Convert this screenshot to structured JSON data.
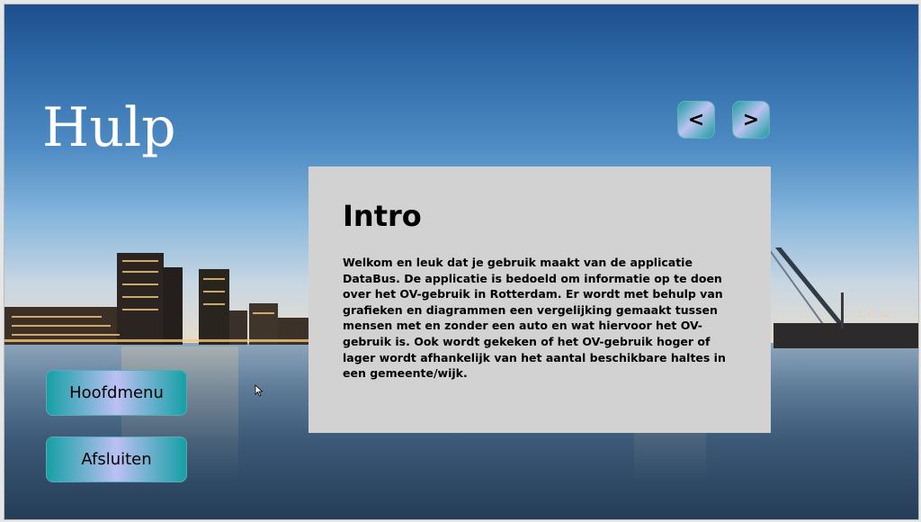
{
  "page": {
    "title": "Hulp"
  },
  "navigation": {
    "prev_label": "<",
    "next_label": ">"
  },
  "panel": {
    "heading": "Intro",
    "body": "Welkom en leuk dat je gebruik maakt van de applicatie DataBus. De applicatie is bedoeld om informatie op te doen over het OV-gebruik in Rotterdam. Er wordt met behulp van grafieken en diagrammen een vergelijking gemaakt tussen mensen met en zonder een auto en wat hiervoor het OV-gebruik is. Ook wordt gekeken of het OV-gebruik hoger of lager wordt afhankelijk van het aantal beschikbare haltes in een gemeente/wijk."
  },
  "menu": {
    "main_menu_label": "Hoofdmenu",
    "exit_label": "Afsluiten"
  },
  "colors": {
    "button_teal": "#15a0a5",
    "button_lavender": "#bcc0f3",
    "panel_bg": "#d2d2d2"
  },
  "icons": {
    "background": "rotterdam-skyline-photo",
    "cursor": "mouse-pointer-icon"
  }
}
